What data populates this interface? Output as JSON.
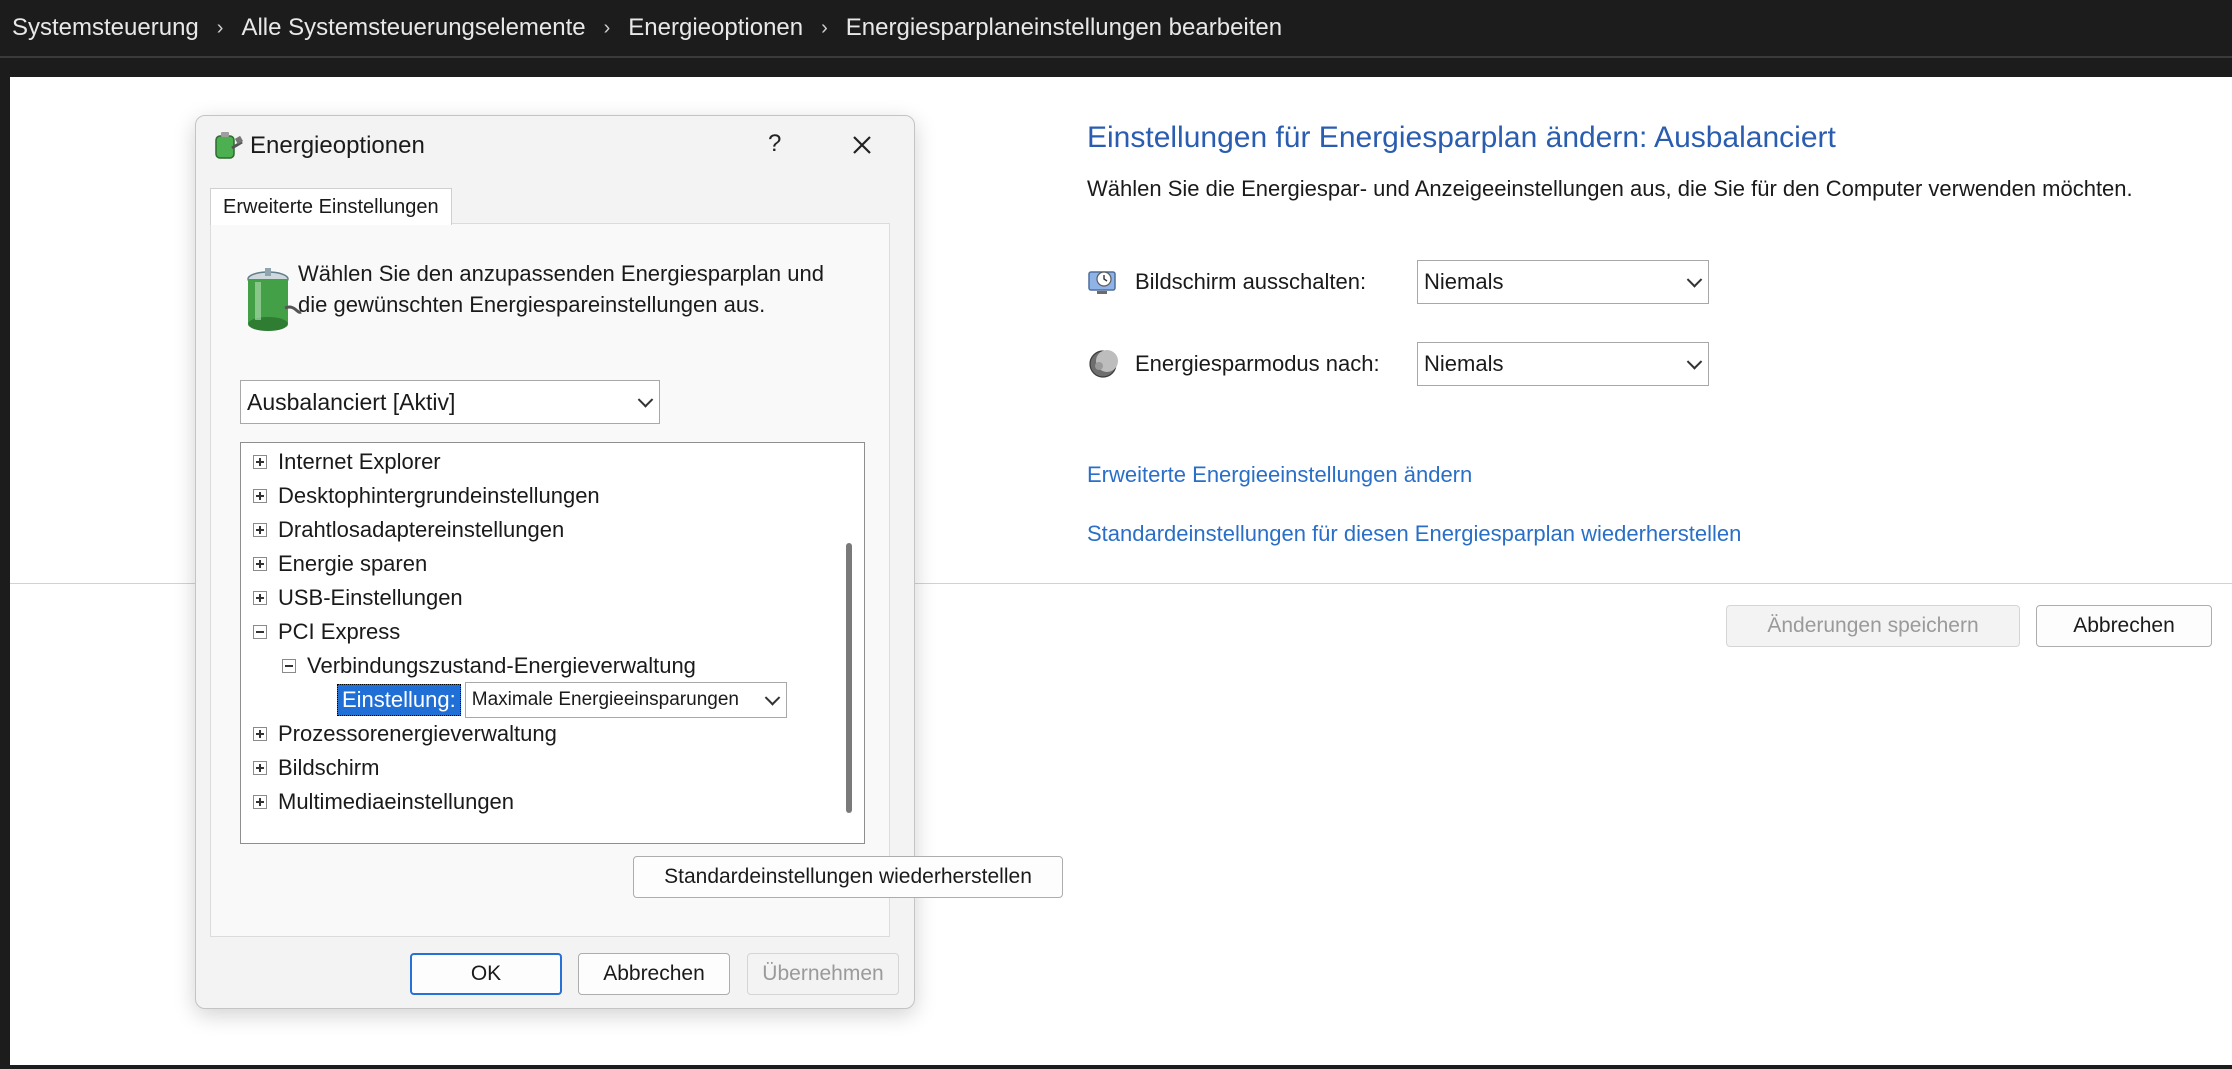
{
  "breadcrumb": [
    "Systemsteuerung",
    "Alle Systemsteuerungselemente",
    "Energieoptionen",
    "Energiesparplaneinstellungen bearbeiten"
  ],
  "plan": {
    "title": "Einstellungen für Energiesparplan ändern: Ausbalanciert",
    "description": "Wählen Sie die Energiespar- und Anzeigeeinstellungen aus, die Sie für den Computer verwenden möchten.",
    "display_off_label": "Bildschirm ausschalten:",
    "display_off_value": "Niemals",
    "sleep_label": "Energiesparmodus nach:",
    "sleep_value": "Niemals",
    "advanced_link": "Erweiterte Energieeinstellungen ändern",
    "restore_link": "Standardeinstellungen für diesen Energiesparplan wiederherstellen",
    "save_button": "Änderungen speichern",
    "cancel_button": "Abbrechen"
  },
  "dialog": {
    "title": "Energieoptionen",
    "help": "?",
    "tab": "Erweiterte Einstellungen",
    "intro": "Wählen Sie den anzupassenden Energiesparplan und die gewünschten Energiespareinstellungen aus.",
    "plan_selected": "Ausbalanciert [Aktiv]",
    "tree": [
      {
        "label": "Internet Explorer",
        "state": "collapsed"
      },
      {
        "label": "Desktophintergrundeinstellungen",
        "state": "collapsed"
      },
      {
        "label": "Drahtlosadaptereinstellungen",
        "state": "collapsed"
      },
      {
        "label": "Energie sparen",
        "state": "collapsed"
      },
      {
        "label": "USB-Einstellungen",
        "state": "collapsed"
      },
      {
        "label": "PCI Express",
        "state": "expanded"
      },
      {
        "label": "Verbindungszustand-Energieverwaltung",
        "state": "expanded"
      },
      {
        "label": "Prozessorenergieverwaltung",
        "state": "collapsed"
      },
      {
        "label": "Bildschirm",
        "state": "collapsed"
      },
      {
        "label": "Multimediaeinstellungen",
        "state": "collapsed"
      }
    ],
    "setting_label": "Einstellung:",
    "setting_value": "Maximale Energieeinsparungen",
    "restore_button": "Standardeinstellungen wiederherstellen",
    "ok_button": "OK",
    "cancel_button": "Abbrechen",
    "apply_button": "Übernehmen"
  },
  "colors": {
    "link": "#2a6fc7",
    "title": "#2a5db0",
    "selection": "#1f6fd6",
    "topbar": "#1c1c1c"
  },
  "icons": [
    "chevron-right-icon",
    "battery-plug-icon",
    "monitor-clock-icon",
    "moon-icon",
    "close-icon",
    "chevron-down-icon",
    "expand-icon",
    "collapse-icon"
  ]
}
